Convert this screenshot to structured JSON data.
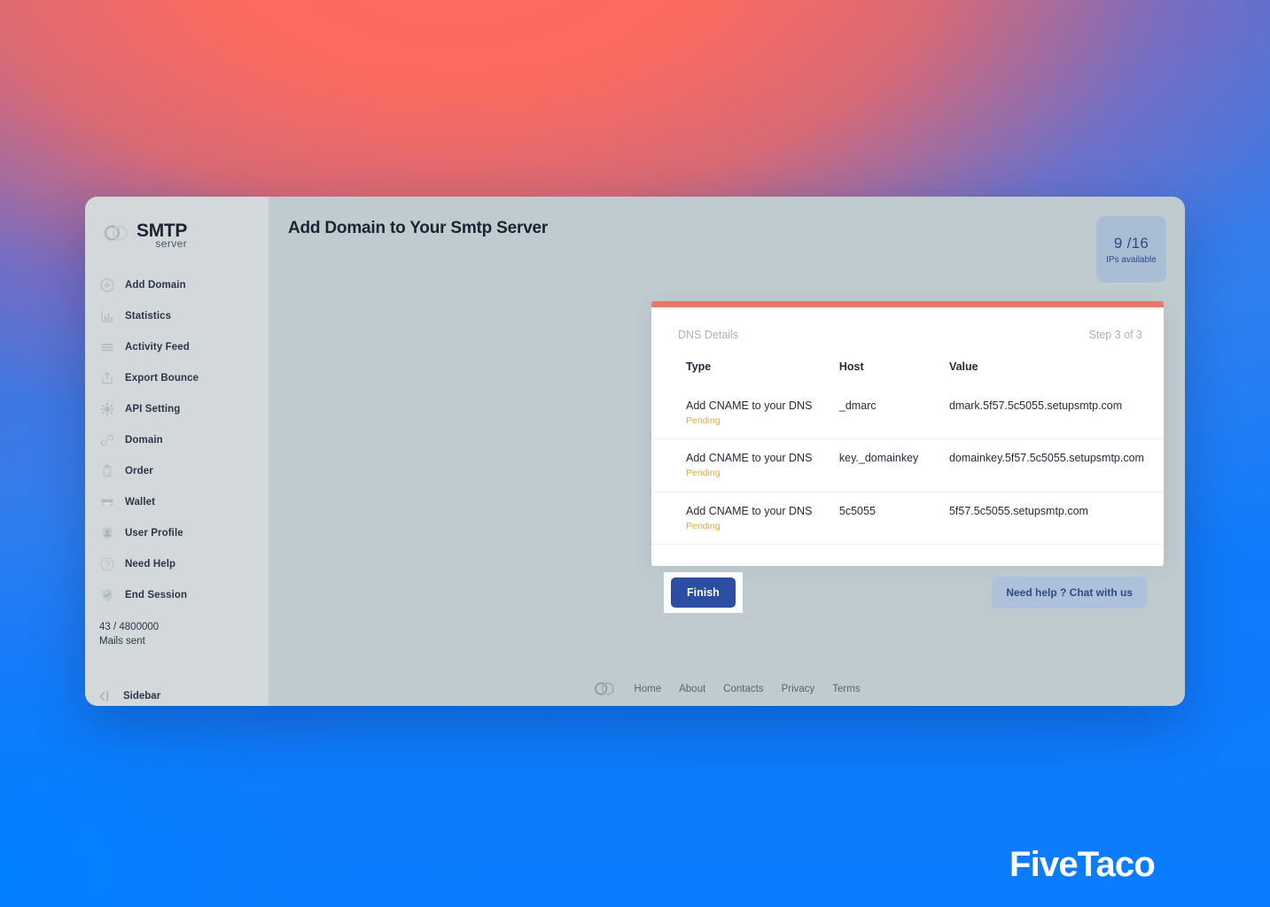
{
  "brand": {
    "title": "SMTP",
    "subtitle": "server",
    "logo_icon": "interlocking-rings-icon"
  },
  "sidebar": {
    "items": [
      {
        "label": "Add Domain",
        "icon": "plus-circle-icon"
      },
      {
        "label": "Statistics",
        "icon": "bar-chart-icon"
      },
      {
        "label": "Activity Feed",
        "icon": "list-lines-icon"
      },
      {
        "label": "Export Bounce",
        "icon": "upload-box-icon"
      },
      {
        "label": "API Setting",
        "icon": "gear-icon"
      },
      {
        "label": "Domain",
        "icon": "link-icon"
      },
      {
        "label": "Order",
        "icon": "clipboard-icon"
      },
      {
        "label": "Wallet",
        "icon": "wallet-icon"
      },
      {
        "label": "User Profile",
        "icon": "shield-user-icon"
      },
      {
        "label": "Need Help",
        "icon": "question-circle-icon"
      },
      {
        "label": "End Session",
        "icon": "shield-check-icon"
      }
    ],
    "mails_count": "43 / 4800000",
    "mails_label": "Mails sent",
    "toggle_label": "Sidebar",
    "toggle_icon": "collapse-left-icon"
  },
  "header": {
    "title": "Add Domain to Your Smtp Server"
  },
  "ips_badge": {
    "count": "9 /16",
    "label": "IPs available"
  },
  "card": {
    "section_title": "DNS Details",
    "step_label": "Step 3 of 3",
    "columns": [
      "Type",
      "Host",
      "Value"
    ],
    "rows": [
      {
        "type": "Add CNAME to your DNS",
        "status": "Pending",
        "host": "_dmarc",
        "value": "dmark.5f57.5c5055.setupsmtp.com"
      },
      {
        "type": "Add CNAME to your DNS",
        "status": "Pending",
        "host": "key._domainkey",
        "value": "domainkey.5f57.5c5055.setupsmtp.com"
      },
      {
        "type": "Add CNAME to your DNS",
        "status": "Pending",
        "host": "5c5055",
        "value": "5f57.5c5055.setupsmtp.com"
      }
    ],
    "finish_label": "Finish",
    "chat_label": "Need help ? Chat with us"
  },
  "footer": {
    "logo_icon": "interlocking-rings-icon",
    "links": [
      "Home",
      "About",
      "Contacts",
      "Privacy",
      "Terms"
    ]
  },
  "watermark": {
    "text": "FiveTaco"
  },
  "colors": {
    "accent_bar": "#e8776b",
    "primary_button": "#2b4ea2",
    "status_pending": "#f5a623",
    "badge_bg": "#a9bdd4",
    "sidebar_bg": "#d3d9da",
    "main_bg": "#c0cbd0"
  }
}
